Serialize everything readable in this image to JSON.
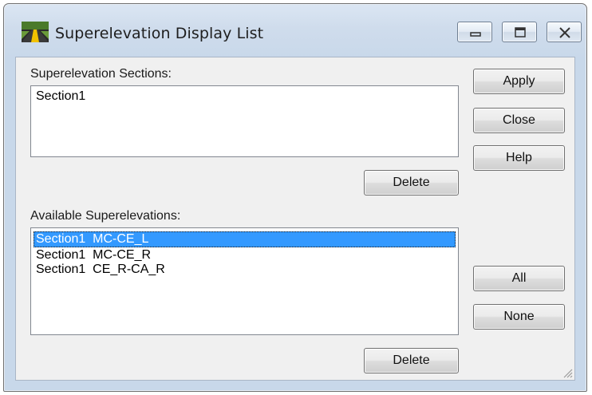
{
  "window": {
    "title": "Superelevation Display List"
  },
  "sections": {
    "label": "Superelevation Sections:",
    "items": [
      "Section1"
    ],
    "delete_label": "Delete"
  },
  "available": {
    "label": "Available Superelevations:",
    "items": [
      {
        "text": "Section1  MC-CE_L",
        "selected": true
      },
      {
        "text": "Section1  MC-CE_R",
        "selected": false
      },
      {
        "text": "Section1  CE_R-CA_R",
        "selected": false
      }
    ],
    "delete_label": "Delete"
  },
  "side_buttons": {
    "apply": "Apply",
    "close": "Close",
    "help": "Help",
    "all": "All",
    "none": "None"
  },
  "colors": {
    "selection": "#3399ff",
    "title_bar": "#dbe6f3"
  }
}
